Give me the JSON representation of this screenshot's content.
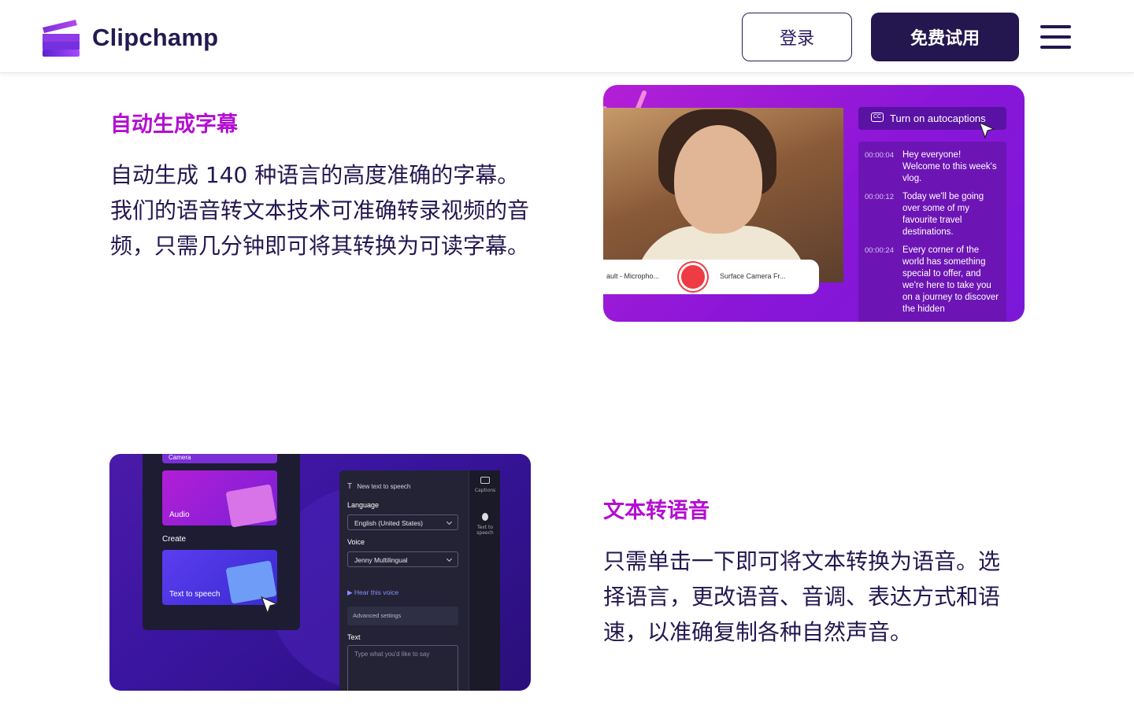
{
  "header": {
    "brand": "Clipchamp",
    "login_label": "登录",
    "trial_label": "免费试用"
  },
  "section1": {
    "title": "自动生成字幕",
    "body": "自动生成 140 种语言的高度准确的字幕。 我们的语音转文本技术可准确转录视频的音频，只需几分钟即可将其转换为可读字幕。"
  },
  "section2": {
    "title": "文本转语音",
    "body": "只需单击一下即可将文本转换为语音。选择语言，更改语音、音调、表达方式和语速，以准确复制各种自然声音。"
  },
  "card1": {
    "autocaptions_label": "Turn on autocaptions",
    "cc_glyph": "CC",
    "mic_label": "ault - Micropho...",
    "camera_label": "Surface Camera Fr...",
    "captions": [
      {
        "time": "00:00:04",
        "text": "Hey everyone! Welcome to this week's vlog."
      },
      {
        "time": "00:00:12",
        "text": "Today we'll be going over some of my favourite travel destinations."
      },
      {
        "time": "00:00:24",
        "text": "Every corner of the world has something special to offer, and we're here to take you on a journey to discover the hidden"
      }
    ]
  },
  "card2": {
    "camera_label": "Camera",
    "audio_label": "Audio",
    "create_label": "Create",
    "tts_card_label": "Text to speech",
    "panel_title": "New text to speech",
    "language_label": "Language",
    "language_value": "English (United States)",
    "voice_label": "Voice",
    "voice_value": "Jenny Multilingual",
    "hear_voice": "Hear this voice",
    "advanced": "Advanced settings",
    "text_label": "Text",
    "text_placeholder": "Type what you'd like to say",
    "side_captions": "Captions",
    "side_tts": "Text to speech"
  },
  "colors": {
    "accent_title": "#b40ed1",
    "navy": "#24164f"
  }
}
